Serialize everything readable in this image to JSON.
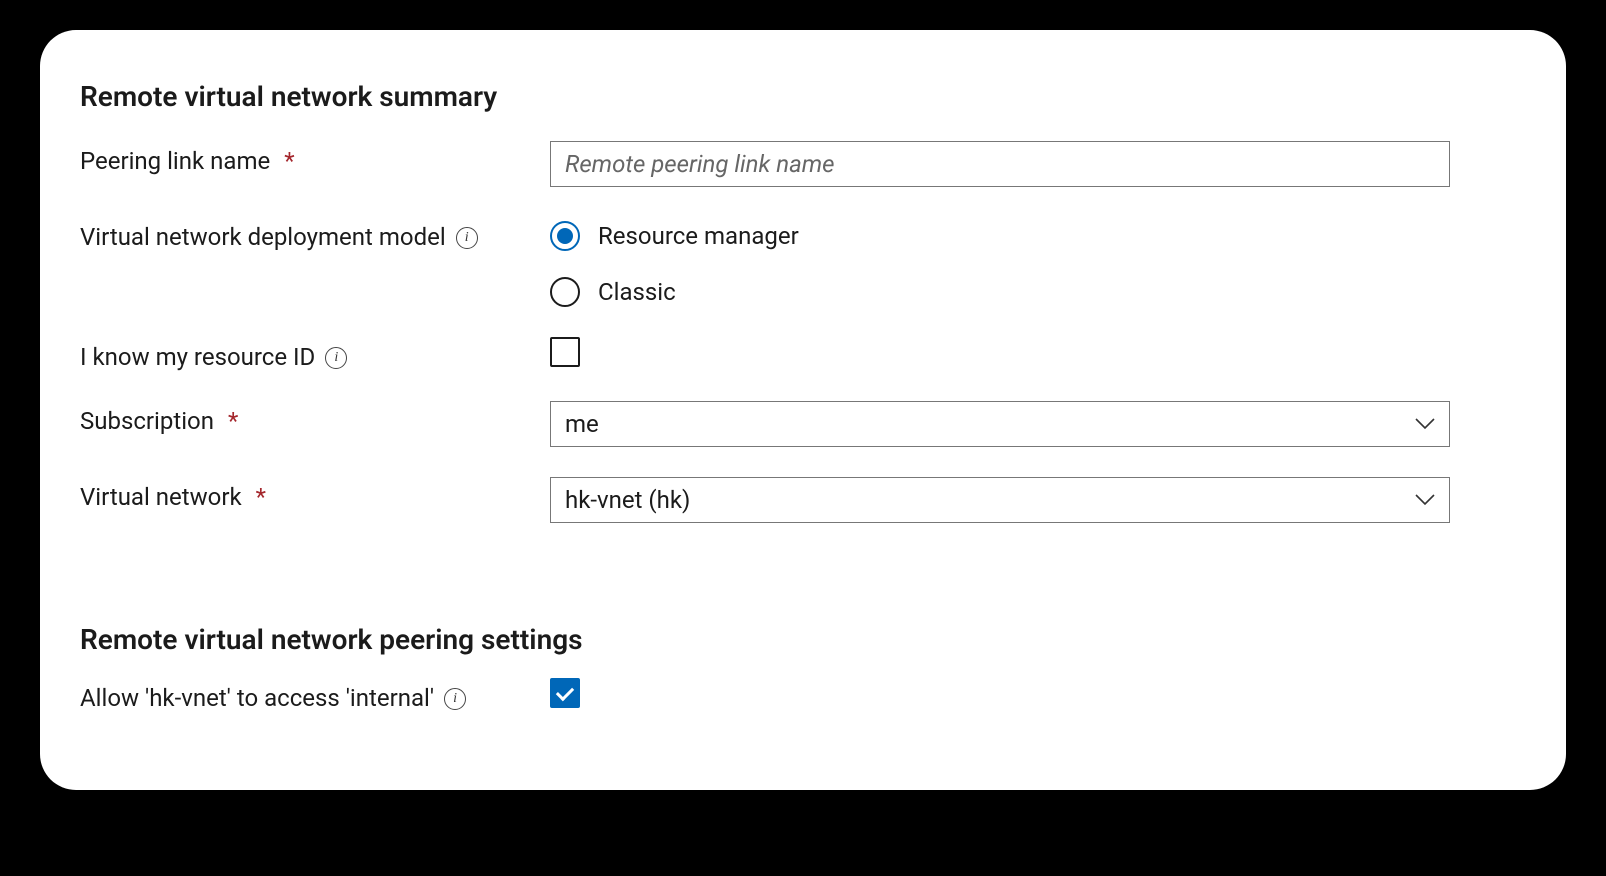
{
  "sections": {
    "summary": {
      "title": "Remote virtual network summary",
      "peering_link": {
        "label": "Peering link name",
        "required_mark": "*",
        "placeholder": "Remote peering link name",
        "value": ""
      },
      "deployment_model": {
        "label": "Virtual network deployment model",
        "options": {
          "resource_manager": "Resource manager",
          "classic": "Classic"
        },
        "selected": "resource_manager"
      },
      "know_resource_id": {
        "label": "I know my resource ID",
        "checked": false
      },
      "subscription": {
        "label": "Subscription",
        "required_mark": "*",
        "value": "me"
      },
      "virtual_network": {
        "label": "Virtual network",
        "required_mark": "*",
        "value": "hk-vnet (hk)"
      }
    },
    "settings": {
      "title": "Remote virtual network peering settings",
      "allow_access": {
        "label": "Allow 'hk-vnet' to access 'internal'",
        "checked": true
      }
    }
  },
  "colors": {
    "accent": "#0067b8",
    "required": "#a4262c"
  }
}
